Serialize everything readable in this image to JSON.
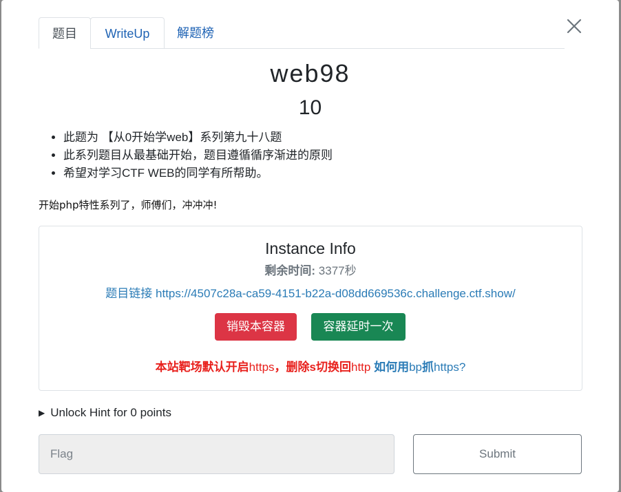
{
  "tabs": [
    {
      "label": "题目",
      "active": true
    },
    {
      "label": "WriteUp",
      "active": false
    },
    {
      "label": "解题榜",
      "active": false
    }
  ],
  "challenge": {
    "title": "web98",
    "points": "10",
    "description": [
      "此题为 【从0开始学web】系列第九十八题",
      "此系列题目从最基础开始，题目遵循循序渐进的原则",
      "希望对学习CTF WEB的同学有所帮助。"
    ],
    "note": "开始php特性系列了，师傅们，冲冲冲!"
  },
  "instance": {
    "title": "Instance Info",
    "remaining_label": "剩余时间:",
    "remaining_value": "3377秒",
    "link_label": "题目链接",
    "link_url": "https://4507c28a-ca59-4151-b22a-d08dd669536c.challenge.ctf.show/",
    "destroy_label": "销毁本容器",
    "extend_label": "容器延时一次",
    "warn_part1": "本站靶场默认开启",
    "warn_part2": "https",
    "warn_part3": "，删除s切换回",
    "warn_part4": "http",
    "howto_part1": "如何用",
    "howto_part2": "bp",
    "howto_part3": "抓",
    "howto_part4": "https?"
  },
  "hint": {
    "label": "Unlock Hint for 0 points"
  },
  "flag": {
    "placeholder": "Flag",
    "value": "",
    "submit_label": "Submit"
  },
  "colors": {
    "link": "#2a7bb6",
    "danger": "#dc3545",
    "success": "#198754",
    "warning_text": "#e8201c"
  }
}
